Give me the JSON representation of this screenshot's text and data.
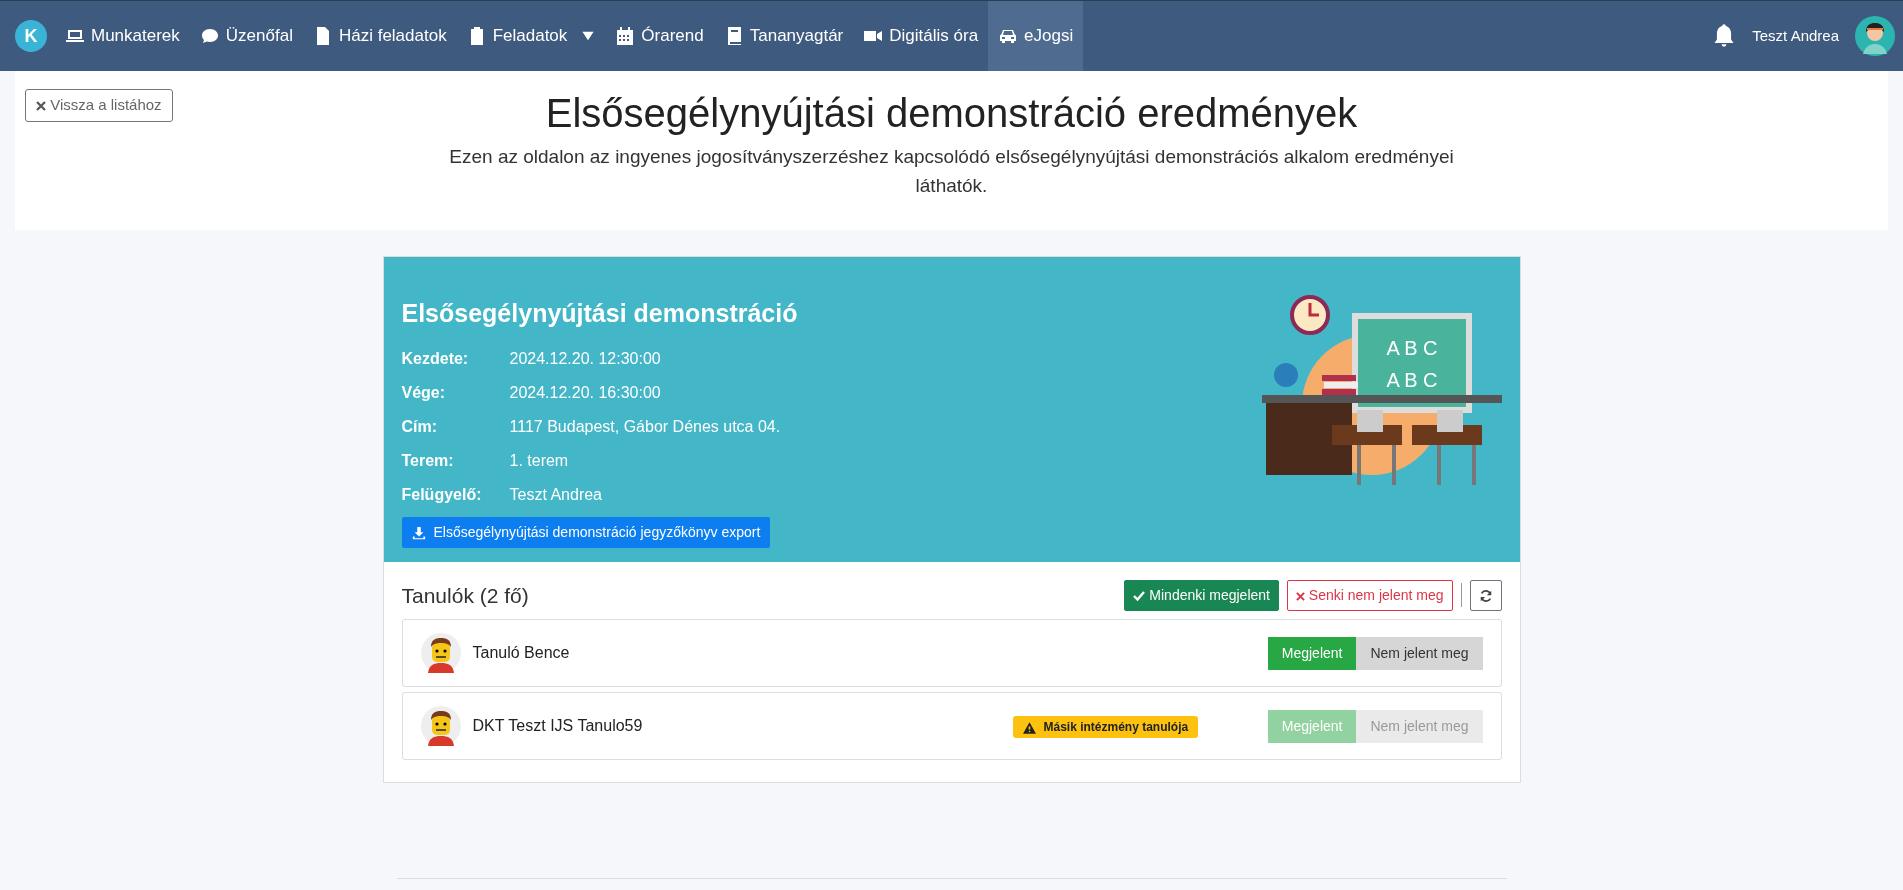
{
  "navbar": {
    "logo": "K",
    "items": [
      {
        "label": "Munkaterek",
        "selected": false,
        "dropdown": false
      },
      {
        "label": "Üzenőfal",
        "selected": false,
        "dropdown": false
      },
      {
        "label": "Házi feladatok",
        "selected": false,
        "dropdown": false
      },
      {
        "label": "Feladatok",
        "selected": false,
        "dropdown": true
      },
      {
        "label": "Órarend",
        "selected": false,
        "dropdown": false
      },
      {
        "label": "Tananyagtár",
        "selected": false,
        "dropdown": false
      },
      {
        "label": "Digitális óra",
        "selected": false,
        "dropdown": false
      },
      {
        "label": "eJogsi",
        "selected": true,
        "dropdown": false
      }
    ],
    "user": "Teszt Andrea"
  },
  "header": {
    "back_button": "Vissza a listához",
    "title": "Elsősegélynyújtási demonstráció eredmények",
    "description": "Ezen az oldalon az ingyenes jogosítványszerzéshez kapcsolódó elsősegélynyújtási demonstrációs alkalom eredményei láthatók."
  },
  "event": {
    "title": "Elsősegélynyújtási demonstráció",
    "details": [
      {
        "label": "Kezdete:",
        "value": "2024.12.20. 12:30:00"
      },
      {
        "label": "Vége:",
        "value": "2024.12.20. 16:30:00"
      },
      {
        "label": "Cím:",
        "value": "1117 Budapest, Gábor Dénes utca 04."
      },
      {
        "label": "Terem:",
        "value": "1. terem"
      },
      {
        "label": "Felügyelő:",
        "value": "Teszt Andrea"
      }
    ],
    "export_button": "Elsősegélynyújtási demonstráció jegyzőkönyv export",
    "board_text": [
      "A B C",
      "A B C"
    ]
  },
  "students": {
    "title": "Tanulók (2 fő)",
    "all_present_button": "Mindenki megjelent",
    "none_present_button": "Senki nem jelent meg",
    "rows": [
      {
        "name": "Tanuló Bence",
        "present_label": "Megjelent",
        "absent_label": "Nem jelent meg",
        "present": true,
        "disabled": false
      },
      {
        "name": "DKT Teszt IJS Tanulo59",
        "present_label": "Megjelent",
        "absent_label": "Nem jelent meg",
        "present": true,
        "disabled": true,
        "warning": "Másik intézmény tanulója"
      }
    ]
  }
}
